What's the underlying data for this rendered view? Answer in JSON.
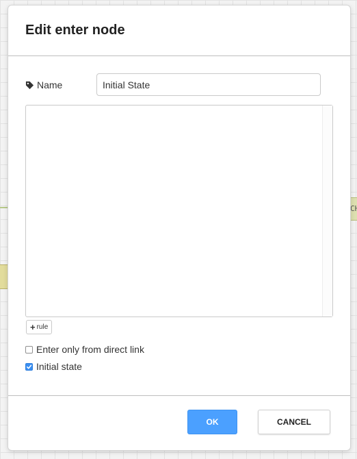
{
  "background": {
    "node_partial_text": "CH"
  },
  "dialog": {
    "title": "Edit enter node",
    "name_label": "Name",
    "name_value": "Initial State",
    "add_rule_label": "rule",
    "options": [
      {
        "label": "Enter only from direct link",
        "checked": false
      },
      {
        "label": "Initial state",
        "checked": true
      }
    ],
    "ok_label": "OK",
    "cancel_label": "CANCEL"
  },
  "colors": {
    "accent": "#4ba0ff",
    "checkbox_checked": "#3b8ff1"
  }
}
